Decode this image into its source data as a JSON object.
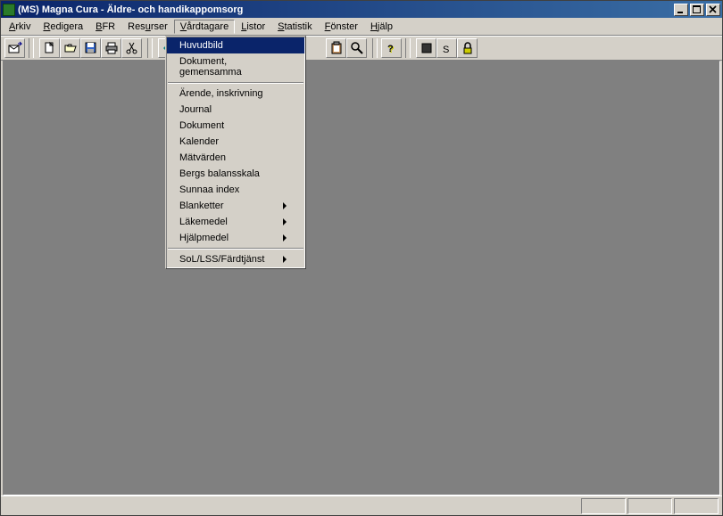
{
  "titlebar": {
    "text": "(MS) Magna Cura - Äldre- och handikappomsorg"
  },
  "menubar": {
    "items": [
      {
        "label": "Arkiv",
        "accel": "A"
      },
      {
        "label": "Redigera",
        "accel": "R"
      },
      {
        "label": "BFR",
        "accel": "B"
      },
      {
        "label": "Resurser",
        "accel": "R"
      },
      {
        "label": "Vårdtagare",
        "accel": "V",
        "open": true
      },
      {
        "label": "Listor",
        "accel": "L"
      },
      {
        "label": "Statistik",
        "accel": "S"
      },
      {
        "label": "Fönster",
        "accel": "F"
      },
      {
        "label": "Hjälp",
        "accel": "H"
      }
    ]
  },
  "dropdown": {
    "items": [
      {
        "label": "Huvudbild",
        "highlight": true
      },
      {
        "label": "Dokument, gemensamma"
      },
      {
        "sep": true
      },
      {
        "label": "Ärende, inskrivning"
      },
      {
        "label": "Journal"
      },
      {
        "label": "Dokument"
      },
      {
        "label": "Kalender"
      },
      {
        "label": "Mätvärden"
      },
      {
        "label": "Bergs balansskala"
      },
      {
        "label": "Sunnaa index"
      },
      {
        "label": "Blanketter",
        "submenu": true
      },
      {
        "label": "Läkemedel",
        "submenu": true
      },
      {
        "label": "Hjälpmedel",
        "submenu": true
      },
      {
        "sep": true
      },
      {
        "label": "SoL/LSS/Färdtjänst",
        "submenu": true
      }
    ]
  },
  "toolbar": {
    "icons": [
      "mail-send",
      "new",
      "open",
      "save",
      "print",
      "cut",
      "nav-first",
      "nav-prev",
      "nav-next",
      "nav-last",
      "user-profile",
      "users-list",
      "user-add",
      "clipboard",
      "search",
      "help",
      "stop",
      "text-s",
      "lock"
    ]
  }
}
